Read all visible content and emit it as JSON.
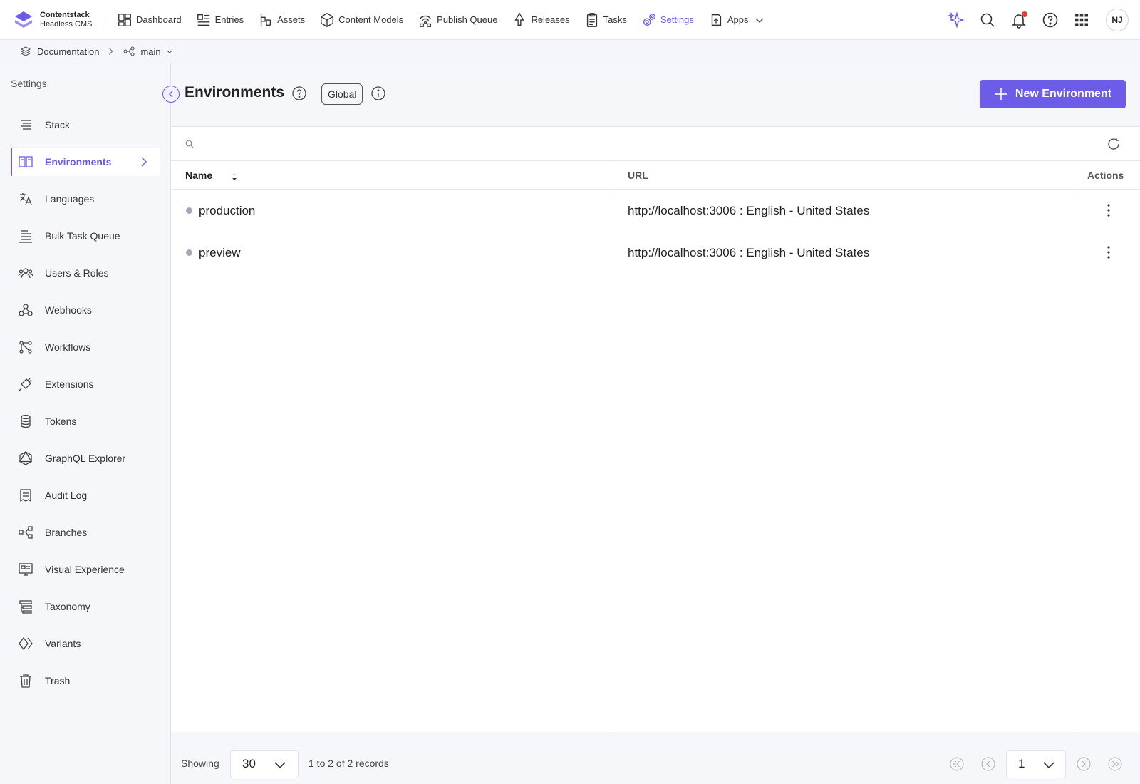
{
  "brand": {
    "name": "Contentstack",
    "subtitle": "Headless CMS"
  },
  "nav": {
    "items": [
      {
        "label": "Dashboard",
        "icon": "dashboard-icon"
      },
      {
        "label": "Entries",
        "icon": "entries-icon"
      },
      {
        "label": "Assets",
        "icon": "assets-icon"
      },
      {
        "label": "Content Models",
        "icon": "content-models-icon"
      },
      {
        "label": "Publish Queue",
        "icon": "publish-queue-icon"
      },
      {
        "label": "Releases",
        "icon": "releases-icon"
      },
      {
        "label": "Tasks",
        "icon": "tasks-icon"
      },
      {
        "label": "Settings",
        "icon": "settings-icon",
        "active": true
      },
      {
        "label": "Apps",
        "icon": "apps-icon"
      }
    ],
    "right_icons": [
      "ai-sparkle-icon",
      "search-icon",
      "bell-icon",
      "help-icon",
      "grid-icon"
    ],
    "avatar": "NJ"
  },
  "breadcrumb": {
    "stack": "Documentation",
    "branch": "main"
  },
  "sidebar": {
    "title": "Settings",
    "items": [
      {
        "label": "Stack",
        "icon": "stack-icon"
      },
      {
        "label": "Environments",
        "icon": "environments-icon",
        "active": true
      },
      {
        "label": "Languages",
        "icon": "languages-icon"
      },
      {
        "label": "Bulk Task Queue",
        "icon": "bulk-task-queue-icon"
      },
      {
        "label": "Users & Roles",
        "icon": "users-roles-icon"
      },
      {
        "label": "Webhooks",
        "icon": "webhooks-icon"
      },
      {
        "label": "Workflows",
        "icon": "workflows-icon"
      },
      {
        "label": "Extensions",
        "icon": "extensions-icon"
      },
      {
        "label": "Tokens",
        "icon": "tokens-icon"
      },
      {
        "label": "GraphQL Explorer",
        "icon": "graphql-icon"
      },
      {
        "label": "Audit Log",
        "icon": "audit-log-icon"
      },
      {
        "label": "Branches",
        "icon": "branches-icon"
      },
      {
        "label": "Visual Experience",
        "icon": "visual-experience-icon"
      },
      {
        "label": "Taxonomy",
        "icon": "taxonomy-icon"
      },
      {
        "label": "Variants",
        "icon": "variants-icon"
      },
      {
        "label": "Trash",
        "icon": "trash-icon"
      }
    ]
  },
  "page": {
    "title": "Environments",
    "badge": "Global",
    "new_button": "New Environment",
    "search_placeholder": ""
  },
  "table": {
    "columns": {
      "name": "Name",
      "url": "URL",
      "actions": "Actions"
    },
    "rows": [
      {
        "name": "production",
        "url": "http://localhost:3006 : English - United States"
      },
      {
        "name": "preview",
        "url": "http://localhost:3006 : English - United States"
      }
    ]
  },
  "footer": {
    "showing_label": "Showing",
    "per_page": "30",
    "records": "1 to 2 of 2 records",
    "page": "1"
  },
  "colors": {
    "accent": "#6c5ce7",
    "text": "#222222",
    "border": "#e2e5ee",
    "panel_bg": "#f6f7fa"
  }
}
